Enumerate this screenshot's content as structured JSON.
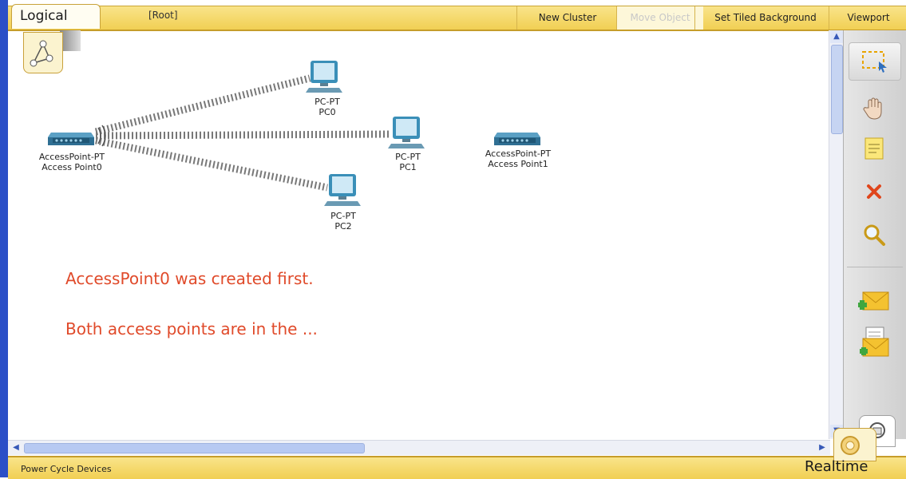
{
  "top_bar": {
    "mode_tab": "Logical",
    "root_label": "[Root]",
    "new_cluster": "New Cluster",
    "move_object": "Move Object",
    "set_tiled_background": "Set Tiled Background",
    "viewport": "Viewport"
  },
  "devices": {
    "ap0": {
      "model": "AccessPoint-PT",
      "name": "Access Point0"
    },
    "ap1": {
      "model": "AccessPoint-PT",
      "name": "Access Point1"
    },
    "pc0": {
      "model": "PC-PT",
      "name": "PC0"
    },
    "pc1": {
      "model": "PC-PT",
      "name": "PC1"
    },
    "pc2": {
      "model": "PC-PT",
      "name": "PC2"
    }
  },
  "notes": {
    "line1": "AccessPoint0 was created first.",
    "line2": "Both access points are in the ..."
  },
  "tools": [
    "select-icon",
    "hand-icon",
    "note-icon",
    "delete-icon",
    "zoom-icon",
    "add-simple-pdu-icon",
    "add-complex-pdu-icon"
  ],
  "bottom_bar": {
    "power_cycle": "Power Cycle Devices",
    "realtime": "Realtime"
  },
  "colors": {
    "bar_yellow": "#f1cf53",
    "note_red": "#e04a2a",
    "frame_blue": "#2b4fc7"
  }
}
